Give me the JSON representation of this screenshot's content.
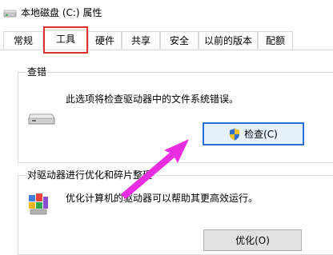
{
  "window": {
    "title": "本地磁盘 (C:) 属性",
    "icon": "drive-icon"
  },
  "tabs": [
    {
      "label": "常规"
    },
    {
      "label": "工具",
      "active": true
    },
    {
      "label": "硬件"
    },
    {
      "label": "共享"
    },
    {
      "label": "安全"
    },
    {
      "label": "以前的版本"
    },
    {
      "label": "配额"
    }
  ],
  "error_check": {
    "title": "查错",
    "description": "此选项将检查驱动器中的文件系统错误。",
    "button_label": "检查(C)",
    "icon": "drive-icon",
    "button_icon": "uac-shield-icon"
  },
  "optimize": {
    "title": "对驱动器进行优化和碎片整理",
    "description": "优化计算机的驱动器可以帮助其更高效运行。",
    "button_label": "优化(O)",
    "icon": "defrag-icon"
  },
  "colors": {
    "highlight_box": "#e52e2e",
    "annotation_arrow": "#e82ee0",
    "focus_border": "#2a6fd6"
  }
}
